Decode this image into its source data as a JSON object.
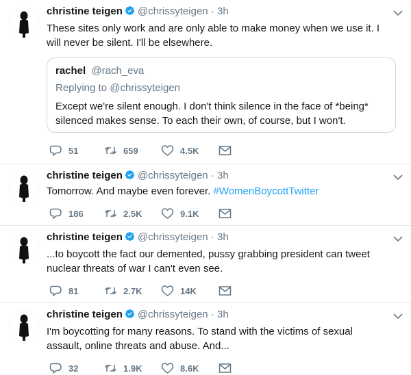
{
  "colors": {
    "accent": "#1da1f2",
    "text": "#14171a",
    "secondary": "#657786",
    "border": "#ccd6dd"
  },
  "tweets": [
    {
      "name": "christine teigen",
      "handle": "@chrissyteigen",
      "dot": "·",
      "time": "3h",
      "text": "These sites only work and are only able to make money when we use it. I will never be silent. I'll be elsewhere.",
      "quote": {
        "name": "rachel",
        "handle": "@rach_eva",
        "replying_to": "Replying to @chrissyteigen",
        "text": "Except we're silent enough. I don't think silence in the face of *being* silenced makes sense. To each their own, of course, but I won't."
      },
      "replies": "51",
      "retweets": "659",
      "likes": "4.5K"
    },
    {
      "name": "christine teigen",
      "handle": "@chrissyteigen",
      "dot": "·",
      "time": "3h",
      "text": "Tomorrow. And maybe even forever.",
      "hashtag": "#WomenBoycottTwitter",
      "replies": "186",
      "retweets": "2.5K",
      "likes": "9.1K"
    },
    {
      "name": "christine teigen",
      "handle": "@chrissyteigen",
      "dot": "·",
      "time": "3h",
      "text": "...to boycott the fact our demented, pussy grabbing president can tweet nuclear threats of war I can't even see.",
      "replies": "81",
      "retweets": "2.7K",
      "likes": "14K"
    },
    {
      "name": "christine teigen",
      "handle": "@chrissyteigen",
      "dot": "·",
      "time": "3h",
      "text": "I'm boycotting for many reasons. To stand with the victims of sexual assault, online threats and abuse. And...",
      "replies": "32",
      "retweets": "1.9K",
      "likes": "8.6K"
    }
  ]
}
